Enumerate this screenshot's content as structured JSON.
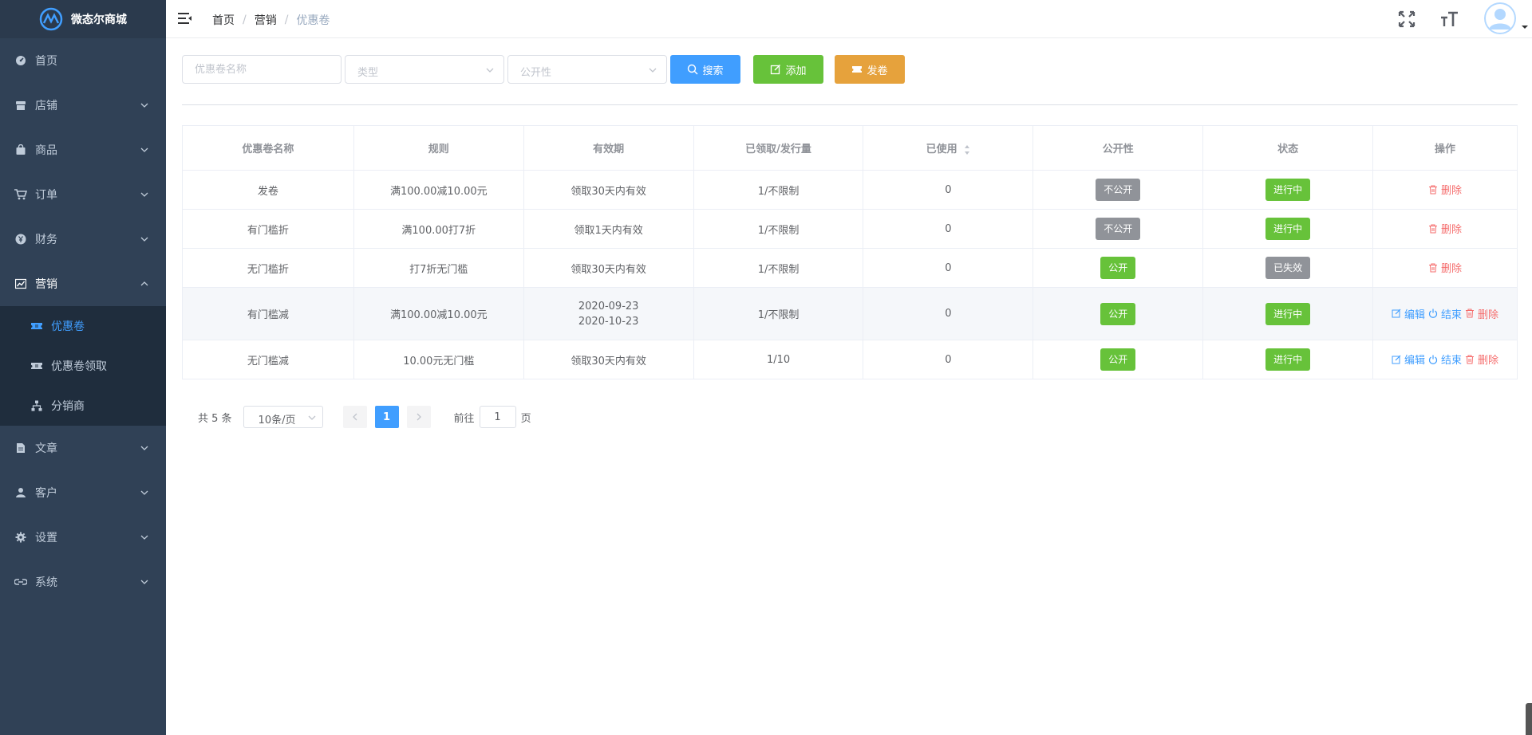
{
  "app": {
    "name": "微态尔商城"
  },
  "sidebar": {
    "items": [
      {
        "label": "首页",
        "icon": "dashboard-icon",
        "expanded": false
      },
      {
        "label": "店铺",
        "icon": "shop-icon",
        "expanded": false
      },
      {
        "label": "商品",
        "icon": "bag-icon",
        "expanded": false
      },
      {
        "label": "订单",
        "icon": "cart-icon",
        "expanded": false
      },
      {
        "label": "财务",
        "icon": "yen-icon",
        "expanded": false
      },
      {
        "label": "营销",
        "icon": "chart-icon",
        "expanded": true
      },
      {
        "label": "文章",
        "icon": "document-icon",
        "expanded": false
      },
      {
        "label": "客户",
        "icon": "user-icon",
        "expanded": false
      },
      {
        "label": "设置",
        "icon": "gear-icon",
        "expanded": false
      },
      {
        "label": "系统",
        "icon": "link-icon",
        "expanded": false
      }
    ],
    "marketing_sub": [
      {
        "label": "优惠卷",
        "icon": "ticket-icon",
        "active": true
      },
      {
        "label": "优惠卷领取",
        "icon": "ticket-icon",
        "active": false
      },
      {
        "label": "分销商",
        "icon": "org-tree-icon",
        "active": false
      }
    ]
  },
  "breadcrumb": [
    "首页",
    "营销",
    "优惠卷"
  ],
  "filters": {
    "name_placeholder": "优惠卷名称",
    "type_placeholder": "类型",
    "public_placeholder": "公开性",
    "search_label": "搜索",
    "add_label": "添加",
    "issue_label": "发卷"
  },
  "table": {
    "headers": [
      "优惠卷名称",
      "规则",
      "有效期",
      "已领取/发行量",
      "已使用",
      "公开性",
      "状态",
      "操作"
    ],
    "rows": [
      {
        "name": "发卷",
        "rule": "满100.00减10.00元",
        "validity": "领取30天内有效",
        "validity2": "",
        "issued": "1/不限制",
        "used": "0",
        "public": "不公开",
        "status": "进行中",
        "ops": [
          "删除"
        ]
      },
      {
        "name": "有门槛折",
        "rule": "满100.00打7折",
        "validity": "领取1天内有效",
        "validity2": "",
        "issued": "1/不限制",
        "used": "0",
        "public": "不公开",
        "status": "进行中",
        "ops": [
          "删除"
        ]
      },
      {
        "name": "无门槛折",
        "rule": "打7折无门槛",
        "validity": "领取30天内有效",
        "validity2": "",
        "issued": "1/不限制",
        "used": "0",
        "public": "公开",
        "status": "已失效",
        "ops": [
          "删除"
        ]
      },
      {
        "name": "有门槛减",
        "rule": "满100.00减10.00元",
        "validity": "2020-09-23",
        "validity2": "2020-10-23",
        "issued": "1/不限制",
        "used": "0",
        "public": "公开",
        "status": "进行中",
        "ops": [
          "编辑",
          "结束",
          "删除"
        ]
      },
      {
        "name": "无门槛减",
        "rule": "10.00元无门槛",
        "validity": "领取30天内有效",
        "validity2": "",
        "issued": "1/10",
        "used": "0",
        "public": "公开",
        "status": "进行中",
        "ops": [
          "编辑",
          "结束",
          "删除"
        ]
      }
    ]
  },
  "pagination": {
    "total": "共 5 条",
    "page_size": "10条/页",
    "current_page": "1",
    "goto_prefix": "前往",
    "goto_value": "1",
    "goto_suffix": "页"
  },
  "colors": {
    "sidebar_bg": "#304156",
    "sidebar_active": "#409eff",
    "primary": "#409eff",
    "success": "#67c23a",
    "warning": "#e6a23c",
    "danger": "#f56c6c",
    "info": "#909399"
  }
}
